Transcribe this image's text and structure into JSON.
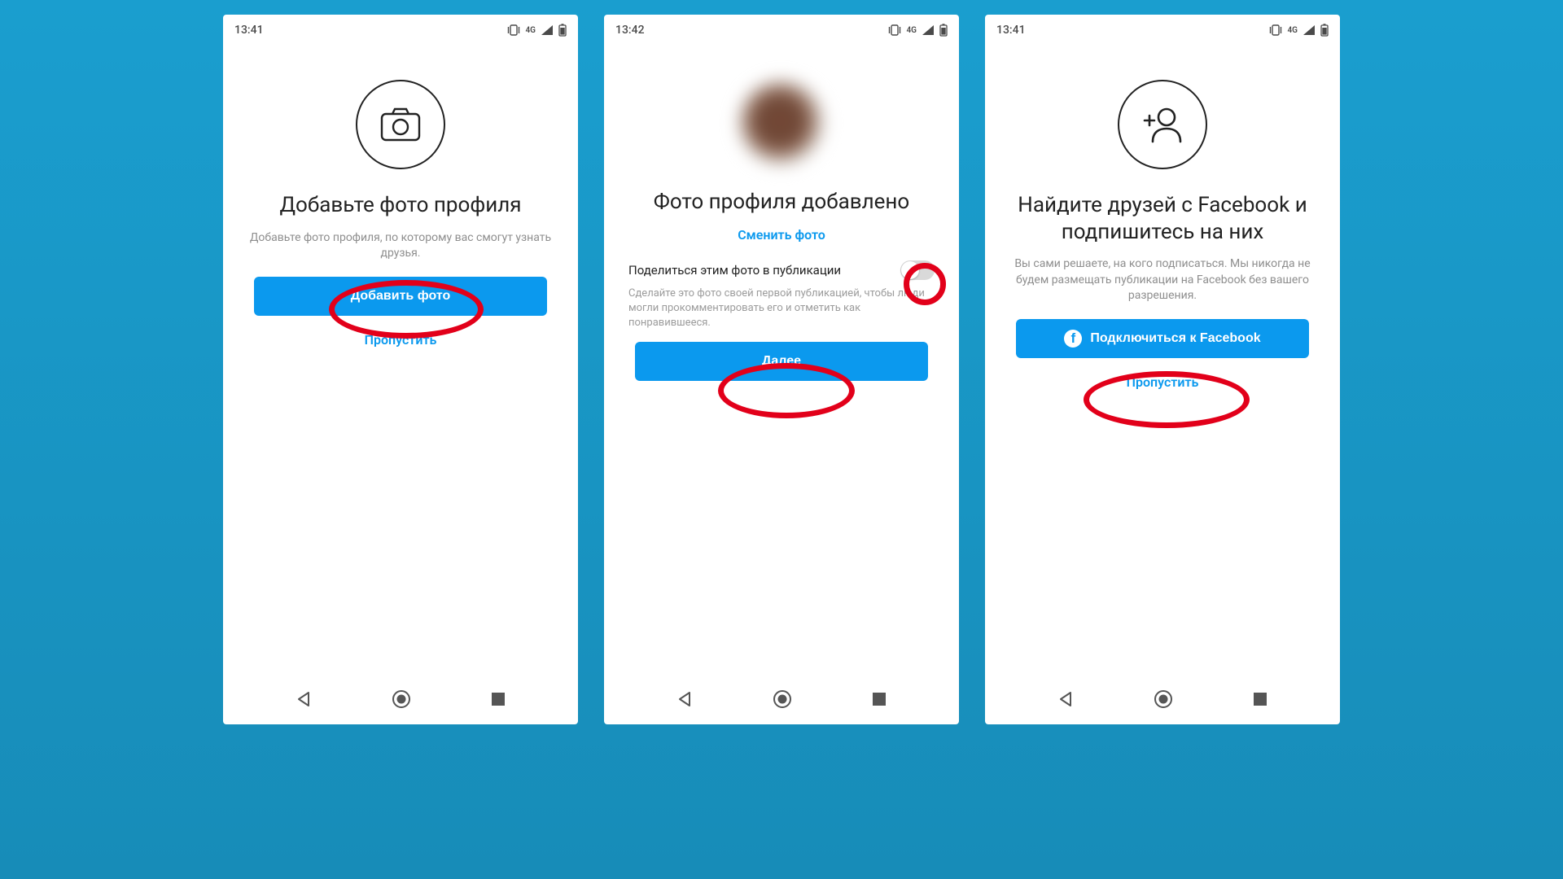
{
  "screens": [
    {
      "statusbar": {
        "time": "13:41",
        "network": "4G"
      },
      "icon": "camera",
      "headline": "Добавьте фото профиля",
      "subtext": "Добавьте фото профиля, по которому вас смогут узнать друзья.",
      "primary_button": "Добавить фото",
      "skip_link": "Пропустить"
    },
    {
      "statusbar": {
        "time": "13:42",
        "network": "4G"
      },
      "headline": "Фото профиля добавлено",
      "change_link": "Сменить фото",
      "toggle_label": "Поделиться этим фото в публикации",
      "toggle_on": false,
      "helper": "Сделайте это фото своей первой публикацией, чтобы люди могли прокомментировать его и отметить как понравившееся.",
      "primary_button": "Далее"
    },
    {
      "statusbar": {
        "time": "13:41",
        "network": "4G"
      },
      "icon": "add-person",
      "headline": "Найдите друзей с Facebook и подпишитесь на них",
      "subtext": "Вы сами решаете, на кого подписаться. Мы никогда не будем размещать публикации на Facebook без вашего разрешения.",
      "primary_button": "Подключиться к Facebook",
      "primary_has_fb_icon": true,
      "skip_link": "Пропустить"
    }
  ]
}
